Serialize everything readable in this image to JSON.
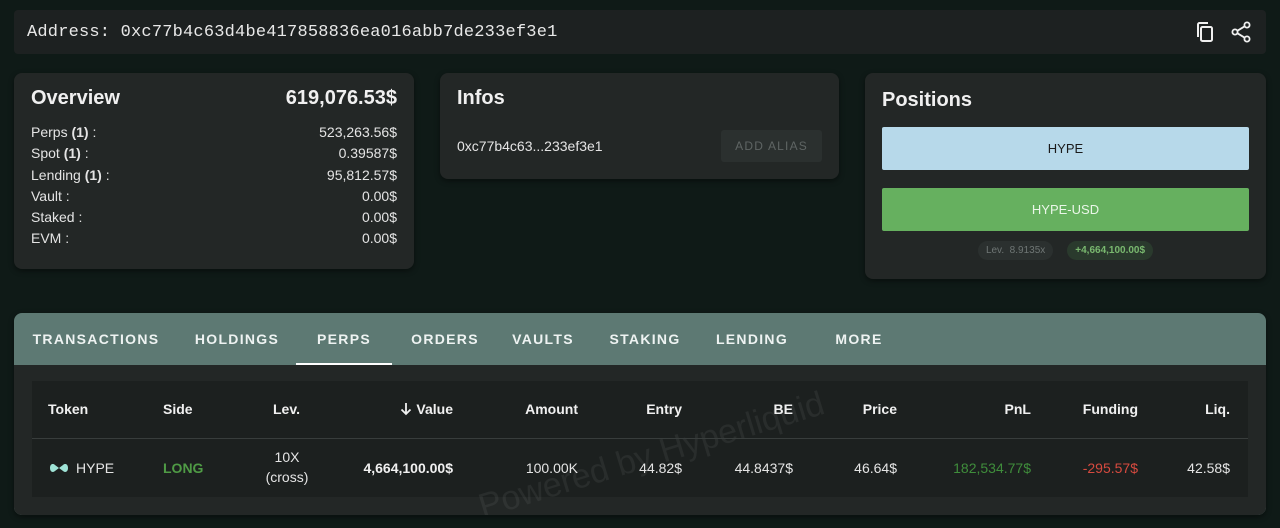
{
  "address_bar": {
    "label": "Address:",
    "address": "0xc77b4c63d4be417858836ea016abb7de233ef3e1",
    "icons": [
      "copy-icon",
      "share-icon"
    ]
  },
  "overview": {
    "title": "Overview",
    "total": "619,076.53$",
    "rows": [
      {
        "label": "Perps",
        "count": "(1)",
        "value": "523,263.56$"
      },
      {
        "label": "Spot",
        "count": "(1)",
        "value": "0.39587$"
      },
      {
        "label": "Lending",
        "count": "(1)",
        "value": "95,812.57$"
      },
      {
        "label": "Vault",
        "count": "",
        "value": "0.00$"
      },
      {
        "label": "Staked",
        "count": "",
        "value": "0.00$"
      },
      {
        "label": "EVM",
        "count": "",
        "value": "0.00$"
      }
    ]
  },
  "infos": {
    "title": "Infos",
    "short_address": "0xc77b4c63...233ef3e1",
    "add_alias_label": "ADD ALIAS"
  },
  "positions": {
    "title": "Positions",
    "bars": [
      "HYPE",
      "HYPE-USD"
    ],
    "leverage_label": "Lev.",
    "leverage_value": "8.9135x",
    "value_badge": "+4,664,100.00$"
  },
  "tabs": [
    "TRANSACTIONS",
    "HOLDINGS",
    "PERPS",
    "ORDERS",
    "VAULTS",
    "STAKING",
    "LENDING",
    "MORE"
  ],
  "active_tab": "PERPS",
  "table": {
    "headers": {
      "token": "Token",
      "side": "Side",
      "lev": "Lev.",
      "value": "Value",
      "amount": "Amount",
      "entry": "Entry",
      "be": "BE",
      "price": "Price",
      "pnl": "PnL",
      "funding": "Funding",
      "liq": "Liq."
    },
    "rows": [
      {
        "token": "HYPE",
        "side": "LONG",
        "lev_line1": "10X",
        "lev_line2": "(cross)",
        "value": "4,664,100.00$",
        "amount": "100.00K",
        "entry": "44.82$",
        "be": "44.8437$",
        "price": "46.64$",
        "pnl": "182,534.77$",
        "funding": "-295.57$",
        "liq": "42.58$"
      }
    ],
    "watermark": "Powered by Hyperliquid"
  },
  "colors": {
    "background": "#0f1a17",
    "card": "#232726",
    "tab_bar": "#5d7973",
    "hype_bar": "#b7d9ea",
    "hype_usd_bar": "#66b05f",
    "long": "#4f9b45",
    "negative": "#d64a3f"
  }
}
